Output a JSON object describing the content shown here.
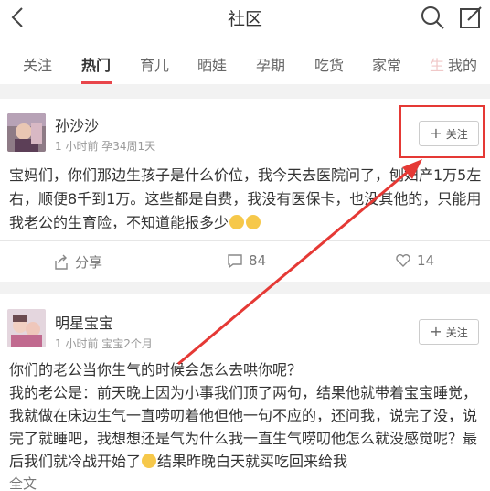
{
  "header": {
    "title": "社区",
    "back_icon": "chevron-left-icon",
    "search_icon": "search-icon",
    "edit_icon": "edit-icon"
  },
  "tabs": [
    {
      "label": "关注",
      "active": false
    },
    {
      "label": "热门",
      "active": true
    },
    {
      "label": "育儿",
      "active": false
    },
    {
      "label": "晒娃",
      "active": false
    },
    {
      "label": "孕期",
      "active": false
    },
    {
      "label": "吃货",
      "active": false
    },
    {
      "label": "家常",
      "active": false
    },
    {
      "label": "生",
      "active": false
    },
    {
      "label": "我的",
      "active": false
    }
  ],
  "posts": [
    {
      "username": "孙沙沙",
      "time": "1 小时前",
      "stage": "孕34周1天",
      "follow_label": "关注",
      "text_1": "宝妈们，你们那边生孩子是什么价位，我今天去医院问了，刨妇产1万5左右，顺便8千到1万。这些都是自费，我没有医保卡，也没其他的，只能用我老公的生育险，不知道能报多少",
      "share_label": "分享",
      "comments": "84",
      "likes": "14"
    },
    {
      "username": "明星宝宝",
      "time": "1 小时前",
      "stage": "宝宝2个月",
      "follow_label": "关注",
      "text_1": "你们的老公当你生气的时候会怎么去哄你呢？",
      "text_2": "我的老公是：前天晚上因为小事我们顶了两句，结果他就带着宝宝睡觉，我就做在床边生气一直唠叨着他但他一句不应的，还问我，说完了没，说完了就睡吧，我想想还是气为什么我一直生气唠叨他怎么就没感觉呢？最后我们就冷战开始了",
      "text_3": "结果昨晚白天就买吃回来给我",
      "fulltext_label": "全文"
    }
  ],
  "colors": {
    "accent": "#e8454a",
    "annotation": "#e53935"
  }
}
